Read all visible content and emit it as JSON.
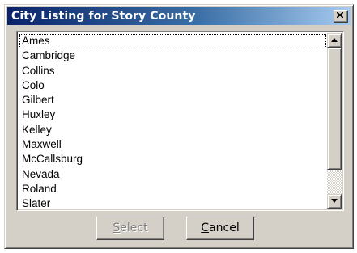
{
  "window": {
    "title": "City Listing for Story County"
  },
  "list": {
    "items": [
      "Ames",
      "Cambridge",
      "Collins",
      "Colo",
      "Gilbert",
      "Huxley",
      "Kelley",
      "Maxwell",
      "McCallsburg",
      "Nevada",
      "Roland",
      "Slater"
    ],
    "focused_item": "Ames"
  },
  "buttons": {
    "select": {
      "mnemonic": "S",
      "rest": "elect",
      "enabled": false
    },
    "cancel": {
      "mnemonic": "C",
      "rest": "ancel",
      "enabled": true
    }
  },
  "colors": {
    "title_gradient_start": "#0a246a",
    "title_gradient_end": "#a6caf0",
    "face": "#d4d0c8",
    "disabled_text": "#808080"
  },
  "icons": {
    "close": "close-icon",
    "scroll_up": "arrow-up-icon",
    "scroll_down": "arrow-down-icon"
  }
}
